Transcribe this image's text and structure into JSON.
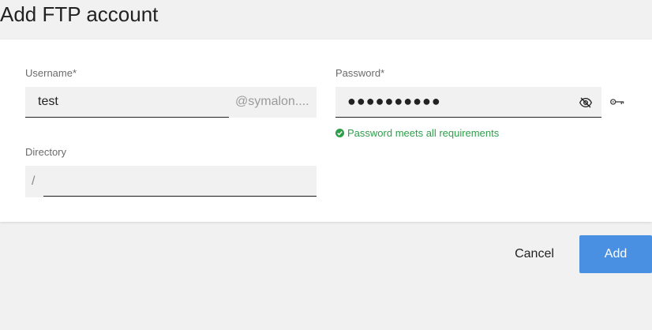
{
  "dialog": {
    "title": "Add FTP account"
  },
  "form": {
    "username": {
      "label": "Username*",
      "value": "test",
      "suffix": "@symalon...."
    },
    "password": {
      "label": "Password*",
      "masked_value": "●●●●●●●●●●",
      "hint": "Password meets all requirements"
    },
    "directory": {
      "label": "Directory",
      "prefix": "/",
      "value": ""
    }
  },
  "actions": {
    "cancel_label": "Cancel",
    "add_label": "Add"
  },
  "colors": {
    "accent": "#4a90e2",
    "success": "#2e9e4a",
    "background": "#f1f1f1"
  },
  "icons": {
    "toggle_visibility": "eye-off-icon",
    "generate_password": "key-icon",
    "hint_status": "check-circle-icon"
  }
}
